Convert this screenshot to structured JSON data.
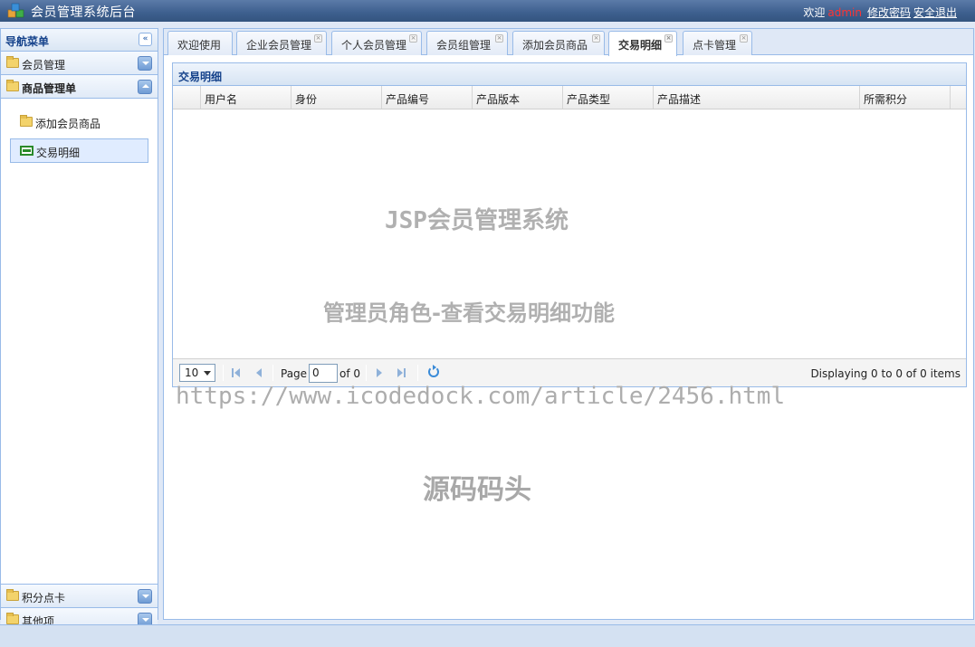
{
  "header": {
    "title": "会员管理系统后台",
    "welcome": "欢迎",
    "username": "admin",
    "change_password": "修改密码",
    "logout": "安全退出"
  },
  "sidebar": {
    "title": "导航菜单",
    "sections": [
      {
        "label": "会员管理"
      },
      {
        "label": "商品管理单"
      },
      {
        "label": "积分点卡"
      },
      {
        "label": "其他项"
      }
    ],
    "items": [
      {
        "label": "添加会员商品"
      },
      {
        "label": "交易明细"
      }
    ]
  },
  "tabs": [
    {
      "label": "欢迎使用"
    },
    {
      "label": "企业会员管理"
    },
    {
      "label": "个人会员管理"
    },
    {
      "label": "会员组管理"
    },
    {
      "label": "添加会员商品"
    },
    {
      "label": "交易明细"
    },
    {
      "label": "点卡管理"
    }
  ],
  "grid": {
    "title": "交易明细",
    "columns": [
      "用户名",
      "身份",
      "产品编号",
      "产品版本",
      "产品类型",
      "产品描述",
      "所需积分"
    ],
    "rows": []
  },
  "pager": {
    "page_size": "10",
    "page_label": "Page",
    "page_value": "0",
    "of_label": "of 0",
    "info": "Displaying 0 to 0 of 0 items"
  },
  "watermarks": {
    "line1": "JSP会员管理系统",
    "line2": "管理员角色-查看交易明细功能",
    "line3": "https://www.icodedock.com/article/2456.html",
    "line4": "源码码头"
  },
  "colors": {
    "header_bg": "#3d5f8e",
    "border": "#99bbe8",
    "title_text": "#15428b",
    "username": "#ff3333"
  }
}
